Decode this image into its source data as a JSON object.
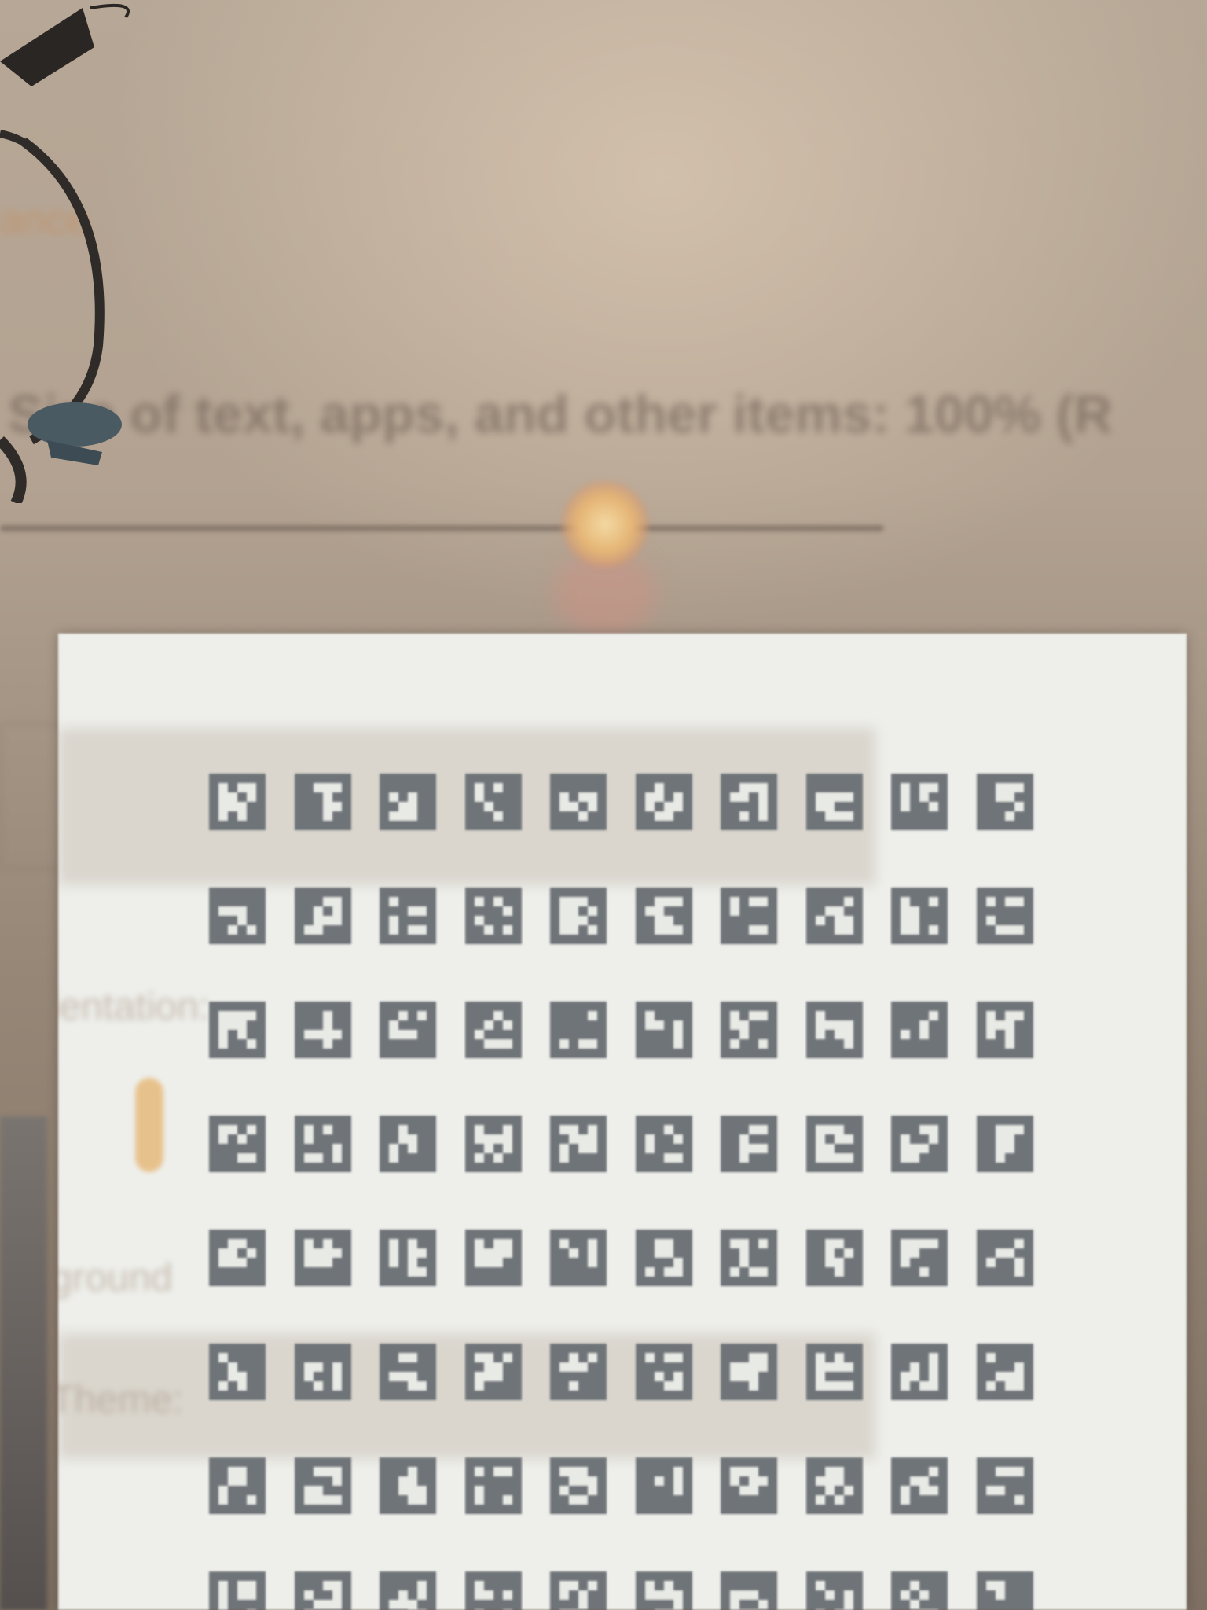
{
  "scene": {
    "heading_fragment": "ance",
    "scale_label": "Size of text, apps, and other items: 100% (R",
    "overlay_labels": [
      "ientation:",
      "ground",
      "Theme:"
    ],
    "colors": {
      "monitor_background": "#b3a291",
      "slider_thumb": "#e5b575",
      "card_background": "#eeefeb",
      "marker_ink": "#6f7478"
    }
  },
  "marker_board": {
    "rows": 8,
    "columns": 10,
    "marker_style": "ArUco-like square fiducial markers"
  }
}
